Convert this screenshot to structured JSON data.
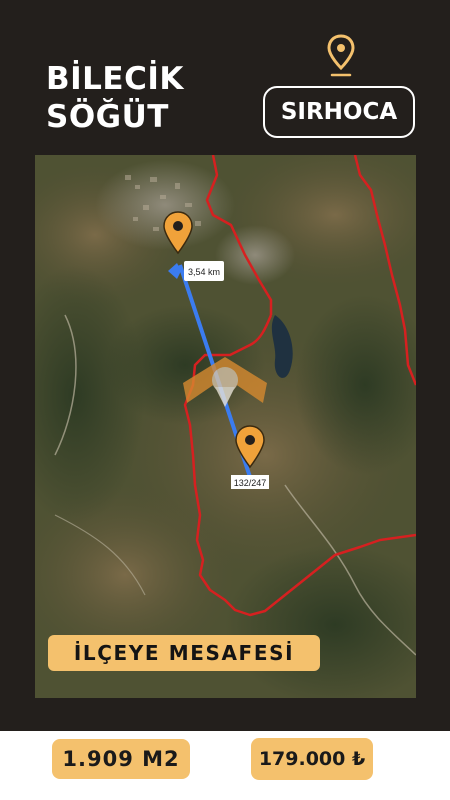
{
  "header": {
    "city_line1": "BİLECİK",
    "city_line2": "SÖĞÜT",
    "village": "SIRHOCA",
    "pin_icon": "location-pin-icon"
  },
  "map": {
    "distance_label": "3,54 km",
    "parcel_label": "132/247",
    "logo": "logo-watermark"
  },
  "distance_banner": "İLÇEYE MESAFESİ",
  "footer": {
    "area": "1.909 M2",
    "price": "179.000 ₺"
  },
  "colors": {
    "background": "#231f1c",
    "accent": "#f4c16d",
    "pin": "#f0a23a",
    "route": "#3b7cf0",
    "boundary": "#d62020"
  }
}
